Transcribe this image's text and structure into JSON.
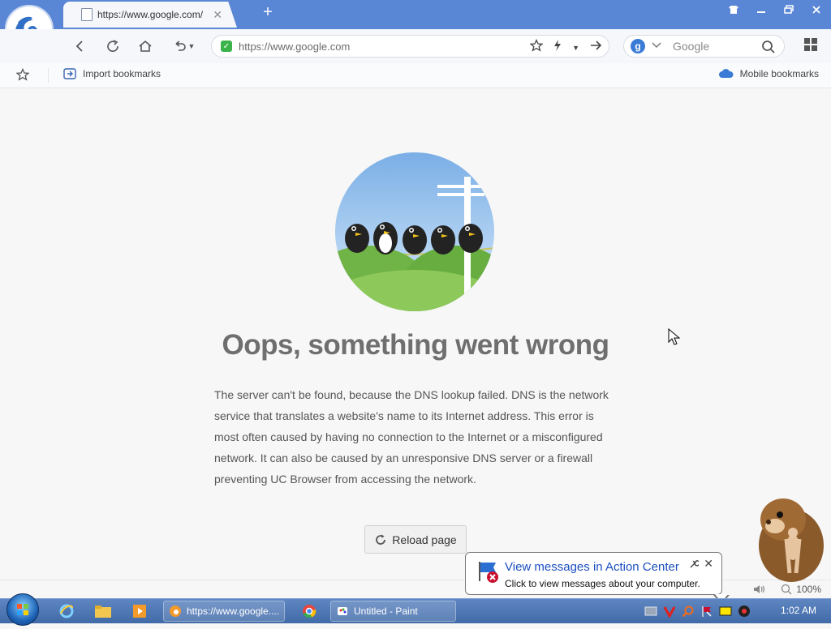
{
  "browser": {
    "tab": {
      "title": "https://www.google.com/"
    },
    "url": "https://www.google.com",
    "search": {
      "placeholder": "Google"
    },
    "bookmarks": {
      "import_label": "Import bookmarks",
      "mobile_label": "Mobile bookmarks"
    }
  },
  "content": {
    "title": "Oops, something went wrong",
    "message": "The server can't be found, because the DNS lookup failed. DNS is the network service that translates a website's name to its Internet address. This error is most often caused by having no connection to the Internet or a misconfigured network. It can also be caused by an unresponsive DNS server or a firewall preventing UC Browser from accessing the network.",
    "reload_label": "Reload page"
  },
  "status": {
    "zoom": "100%"
  },
  "notification": {
    "title": "View messages in Action Center",
    "text": "Click to view messages about your computer."
  },
  "taskbar": {
    "items": [
      {
        "label": "https://www.google...."
      },
      {
        "label": "Untitled - Paint"
      }
    ],
    "clock": "1:02 AM"
  },
  "colors": {
    "titlebar": "#5a86d6",
    "accent_green": "#3cb34a",
    "title_text": "#6f6f6f",
    "link_blue": "#1a4fbf"
  }
}
